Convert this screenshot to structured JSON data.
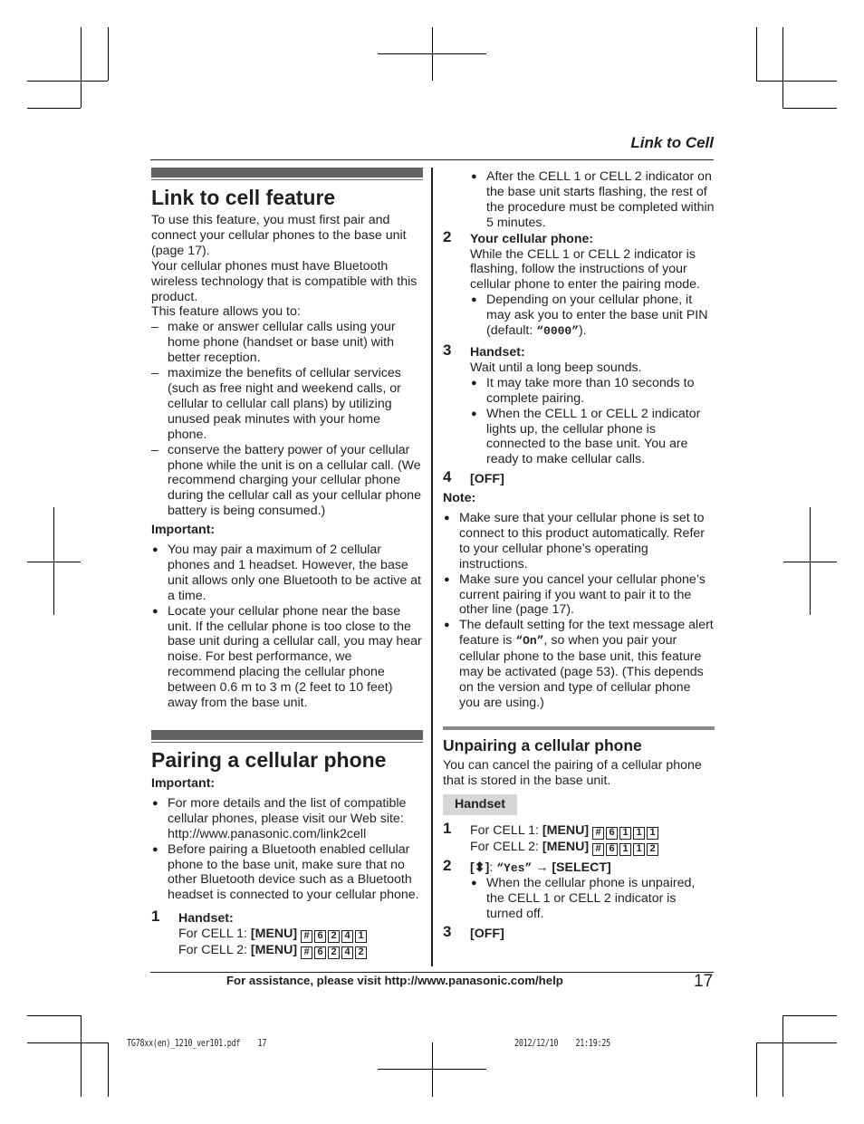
{
  "header": {
    "running_title": "Link to Cell"
  },
  "left": {
    "section1": {
      "title": "Link to cell feature",
      "intro": [
        "To use this feature, you must first pair and connect your cellular phones to the base unit (page 17).",
        "Your cellular phones must have Bluetooth wireless technology that is compatible with this product.",
        "This feature allows you to:"
      ],
      "dash_items": [
        "make or answer cellular calls using your home phone (handset or base unit) with better reception.",
        "maximize the benefits of cellular services (such as free night and weekend calls, or cellular to cellular call plans) by utilizing unused peak minutes with your home phone.",
        "conserve the battery power of your cellular phone while the unit is on a cellular call. (We recommend charging your cellular phone during the cellular call as your cellular phone battery is being consumed.)"
      ],
      "important_label": "Important:",
      "important_items": [
        "You may pair a maximum of 2 cellular phones and 1 headset. However, the base unit allows only one Bluetooth to be active at a time.",
        "Locate your cellular phone near the base unit. If the cellular phone is too close to the base unit during a cellular call, you may hear noise. For best performance, we recommend placing the cellular phone between 0.6 m to 3 m (2 feet to 10 feet) away from the base unit."
      ]
    },
    "section2": {
      "title": "Pairing a cellular phone",
      "important_label": "Important:",
      "important_items": [
        "For more details and the list of compatible cellular phones, please visit our Web site: http://www.panasonic.com/link2cell",
        "Before pairing a Bluetooth enabled cellular phone to the base unit, make sure that no other Bluetooth device such as a Bluetooth headset is connected to your cellular phone."
      ],
      "step1": {
        "num": "1",
        "label": "Handset:",
        "cell1_prefix": "For CELL 1: ",
        "cell2_prefix": "For CELL 2: ",
        "menu_key": "[MENU]",
        "cell1_keys": [
          "#",
          "6",
          "2",
          "4",
          "1"
        ],
        "cell2_keys": [
          "#",
          "6",
          "2",
          "4",
          "2"
        ]
      }
    }
  },
  "right": {
    "step1_bullet": "After the CELL 1 or CELL 2 indicator on the base unit starts flashing, the rest of the procedure must be completed within 5 minutes.",
    "step2": {
      "num": "2",
      "label": "Your cellular phone:",
      "text": "While the CELL 1 or CELL 2 indicator is flashing, follow the instructions of your cellular phone to enter the pairing mode.",
      "bullet_pre": "Depending on your cellular phone, it may ask you to enter the base unit PIN (default: ",
      "bullet_code": "“0000”",
      "bullet_post": ")."
    },
    "step3": {
      "num": "3",
      "label": "Handset:",
      "text": "Wait until a long beep sounds.",
      "bullets": [
        "It may take more than 10 seconds to complete pairing.",
        "When the CELL 1 or CELL 2 indicator lights up, the cellular phone is connected to the base unit. You are ready to make cellular calls."
      ]
    },
    "step4": {
      "num": "4",
      "key": "[OFF]"
    },
    "note_label": "Note:",
    "notes": [
      "Make sure that your cellular phone is set to connect to this product automatically. Refer to your cellular phone’s operating instructions.",
      "Make sure you cancel your cellular phone’s current pairing if you want to pair it to the other line (page 17)."
    ],
    "note3": {
      "pre": "The default setting for the text message alert feature is ",
      "code": "“On”",
      "post": ", so when you pair your cellular phone to the base unit, this feature may be activated (page 53). (This depends on the version and type of cellular phone you are using.)"
    },
    "unpair": {
      "title": "Unpairing a cellular phone",
      "intro": "You can cancel the pairing of a cellular phone that is stored in the base unit.",
      "tab": "Handset",
      "step1": {
        "num": "1",
        "cell1_prefix": "For CELL 1: ",
        "cell2_prefix": "For CELL 2: ",
        "menu_key": "[MENU]",
        "cell1_keys": [
          "#",
          "6",
          "1",
          "1",
          "1"
        ],
        "cell2_keys": [
          "#",
          "6",
          "1",
          "1",
          "2"
        ]
      },
      "step2": {
        "num": "2",
        "nav_key": "[⬍]",
        "colon": ": ",
        "option": "“Yes”",
        "arrow": " → ",
        "select_key": "[SELECT]",
        "bullet": "When the cellular phone is unpaired, the CELL 1 or CELL 2 indicator is turned off."
      },
      "step3": {
        "num": "3",
        "key": "[OFF]"
      }
    }
  },
  "footer": {
    "assistance": "For assistance, please visit http://www.panasonic.com/help",
    "page_number": "17",
    "slug_file": "TG78xx(en)_1210_ver101.pdf    17",
    "slug_date": "2012/12/10    21:19:25"
  }
}
